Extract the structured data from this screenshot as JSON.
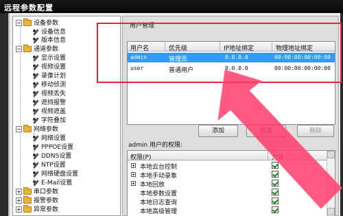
{
  "window": {
    "title": "远程参数配置"
  },
  "tree": {
    "items": [
      {
        "label": "设备参数",
        "kind": "folder",
        "expanded": true
      },
      {
        "label": "设备信息",
        "kind": "leaf"
      },
      {
        "label": "版本信息",
        "kind": "leaf"
      },
      {
        "label": "通道参数",
        "kind": "folder",
        "expanded": true
      },
      {
        "label": "显示设置",
        "kind": "leaf"
      },
      {
        "label": "视频设置",
        "kind": "leaf"
      },
      {
        "label": "录像计划",
        "kind": "leaf"
      },
      {
        "label": "移动侦测",
        "kind": "leaf"
      },
      {
        "label": "视频丢失",
        "kind": "leaf"
      },
      {
        "label": "遮挡报警",
        "kind": "leaf"
      },
      {
        "label": "视频遮盖",
        "kind": "leaf"
      },
      {
        "label": "字符叠加",
        "kind": "leaf"
      },
      {
        "label": "网络参数",
        "kind": "folder",
        "expanded": true
      },
      {
        "label": "网络设置",
        "kind": "leaf"
      },
      {
        "label": "PPPOE设置",
        "kind": "leaf"
      },
      {
        "label": "DDNS设置",
        "kind": "leaf"
      },
      {
        "label": "NTP设置",
        "kind": "leaf"
      },
      {
        "label": "网络硬盘设置",
        "kind": "leaf"
      },
      {
        "label": "E-Mail设置",
        "kind": "leaf"
      },
      {
        "label": "串口参数",
        "kind": "folder",
        "expanded": false
      },
      {
        "label": "报警参数",
        "kind": "folder",
        "expanded": false
      },
      {
        "label": "异常参数",
        "kind": "folder",
        "expanded": false
      }
    ]
  },
  "user_management": {
    "title": "用户管理",
    "columns": [
      "用户名",
      "优先级",
      "IP地址绑定",
      "物理地址绑定"
    ],
    "rows": [
      {
        "username": "admin",
        "priority": "管理员",
        "ip": "0.0.0.0",
        "mac": "00:00:00:00:00:00",
        "selected": true
      },
      {
        "username": "user",
        "priority": "普通用户",
        "ip": "0.0.0.0",
        "mac": "00:00:00:00:00:00",
        "selected": false
      }
    ],
    "buttons": {
      "add": "添加",
      "modify": "修改",
      "delete": "删除"
    }
  },
  "permissions": {
    "label": "admin 用户的权限:",
    "columns": [
      "权限(P)",
      "允许"
    ],
    "items": [
      {
        "label": "本地云台控制",
        "expandable": true,
        "allowed": true
      },
      {
        "label": "本地手动录象",
        "expandable": true,
        "allowed": true
      },
      {
        "label": "本地回放",
        "expandable": true,
        "allowed": true
      },
      {
        "label": "本地参数设置",
        "expandable": false,
        "allowed": true
      },
      {
        "label": "本地日志查询",
        "expandable": false,
        "allowed": true
      },
      {
        "label": "本地高级管理",
        "expandable": false,
        "allowed": true
      }
    ]
  },
  "annotation": {
    "highlight_color": "#e8243a",
    "arrow_color": "#ff3b6b"
  }
}
